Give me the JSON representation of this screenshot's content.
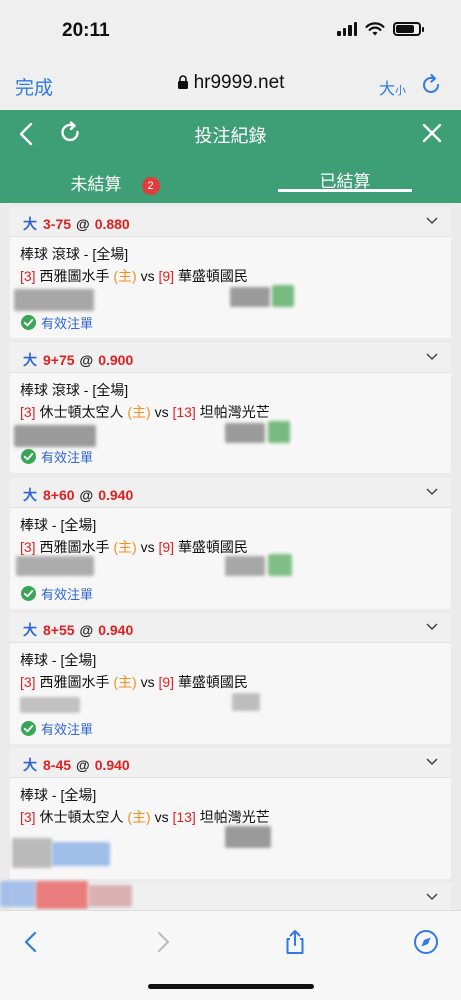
{
  "status_bar": {
    "time": "20:11"
  },
  "browser": {
    "done_label": "完成",
    "url": "hr9999.net",
    "text_size_label": "大",
    "text_size_small": "小"
  },
  "header": {
    "title": "投注紀錄"
  },
  "tabs": [
    {
      "label": "未結算",
      "badge": "2"
    },
    {
      "label": "已結算",
      "active": true
    }
  ],
  "bets": [
    {
      "type": "大",
      "line": "3-75",
      "at": "@",
      "odds": "0.880",
      "league": "棒球 滾球 - [全場]",
      "home_rank": "[3]",
      "home_team": "西雅圖水手",
      "home_tag": "(主)",
      "vs": "vs",
      "away_rank": "[9]",
      "away_team": "華盛頓國民",
      "status": "有效注單"
    },
    {
      "type": "大",
      "line": "9+75",
      "at": "@",
      "odds": "0.900",
      "league": "棒球 滾球 - [全場]",
      "home_rank": "[3]",
      "home_team": "休士頓太空人",
      "home_tag": "(主)",
      "vs": "vs",
      "away_rank": "[13]",
      "away_team": "坦帕灣光芒",
      "status": "有效注單"
    },
    {
      "type": "大",
      "line": "8+60",
      "at": "@",
      "odds": "0.940",
      "league": "棒球 - [全場]",
      "home_rank": "[3]",
      "home_team": "西雅圖水手",
      "home_tag": "(主)",
      "vs": "vs",
      "away_rank": "[9]",
      "away_team": "華盛頓國民",
      "status": "有效注單"
    },
    {
      "type": "大",
      "line": "8+55",
      "at": "@",
      "odds": "0.940",
      "league": "棒球 - [全場]",
      "home_rank": "[3]",
      "home_team": "西雅圖水手",
      "home_tag": "(主)",
      "vs": "vs",
      "away_rank": "[9]",
      "away_team": "華盛頓國民",
      "status": "有效注單"
    },
    {
      "type": "大",
      "line": "8-45",
      "at": "@",
      "odds": "0.940",
      "league": "棒球 - [全場]",
      "home_rank": "[3]",
      "home_team": "休士頓太空人",
      "home_tag": "(主)",
      "vs": "vs",
      "away_rank": "[13]",
      "away_team": "坦帕灣光芒",
      "status": ""
    }
  ],
  "colors": {
    "header_green": "#3e9e76",
    "link_blue": "#2f7ae5",
    "odds_red": "#e02020",
    "home_orange": "#f0901e",
    "badge_red": "#e23b3b"
  },
  "icons": [
    "lock-icon",
    "reload-icon",
    "back-icon",
    "refresh-icon",
    "close-icon",
    "chevron-down-icon",
    "check-icon",
    "share-icon",
    "compass-icon"
  ]
}
